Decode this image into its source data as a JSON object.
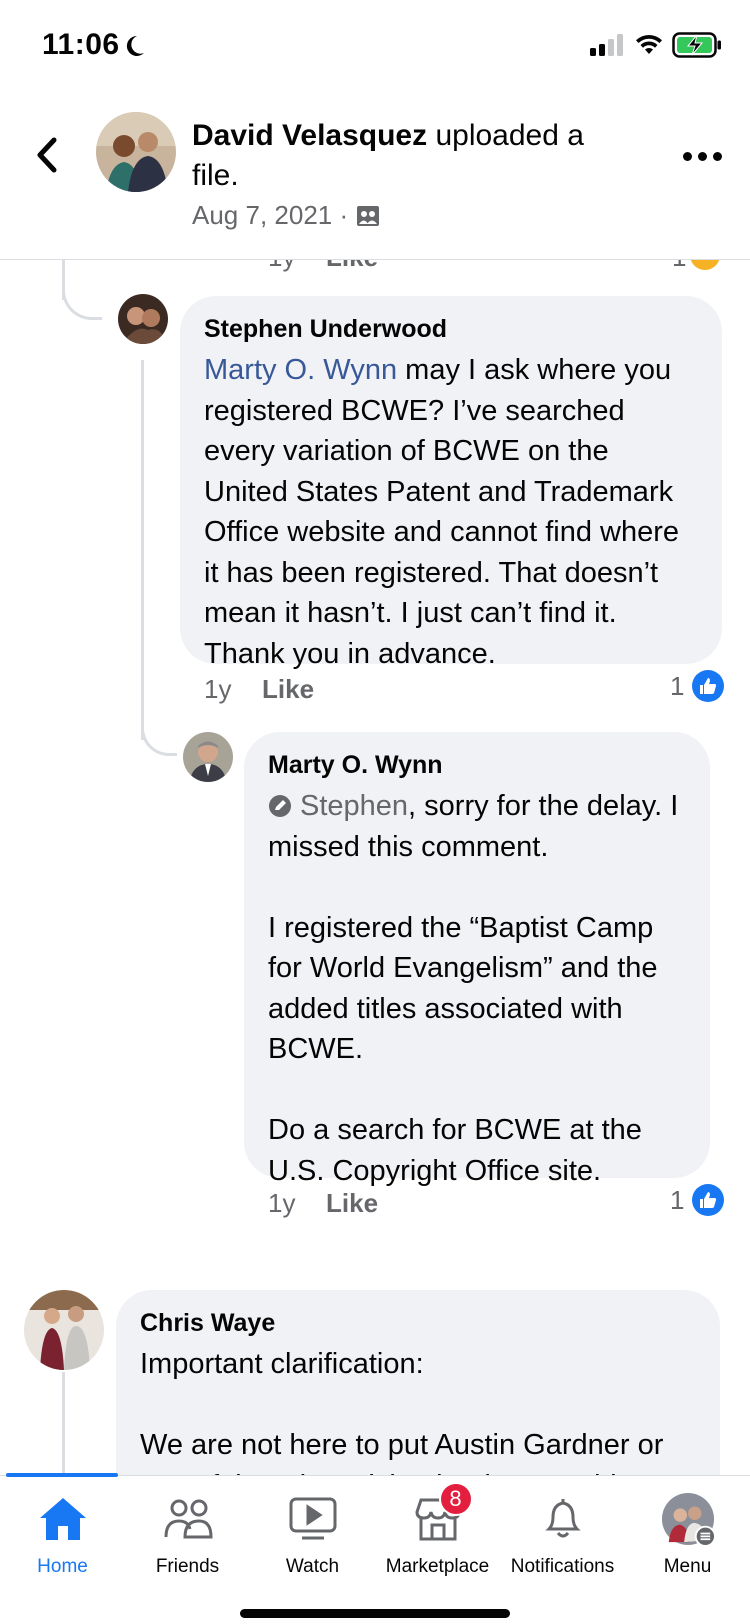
{
  "status_bar": {
    "time": "11:06"
  },
  "header": {
    "author": "David Velasquez",
    "action": " uploaded a file.",
    "date": "Aug 7, 2021 · "
  },
  "cutoff_comment": {
    "time": "1y",
    "like_label": "Like",
    "reaction_count": "1"
  },
  "comments": [
    {
      "author": "Stephen Underwood",
      "mention": "Marty O. Wynn",
      "text": " may I ask where you registered BCWE? I’ve searched every variation of BCWE on the United States Patent and Trademark Office website and cannot find where it has been registered. That doesn’t mean it hasn’t. I just can’t find it. Thank you in advance.",
      "time": "1y",
      "like_label": "Like",
      "reaction_count": "1"
    },
    {
      "author": "Marty O. Wynn",
      "mention": "Stephen",
      "text": ", sorry for the delay. I missed this comment.\n\nI registered the “Baptist Camp for World Evangelism” and the added titles associated with BCWE.\n\nDo a search for BCWE at the U.S. Copyright Office site.",
      "time": "1y",
      "like_label": "Like",
      "reaction_count": "1"
    },
    {
      "author": "Chris Waye",
      "text": "Important clarification:\n\nWe are not here to put Austin Gardner or any of the other Vision leaders outside"
    }
  ],
  "tabs": [
    {
      "label": "Home",
      "icon": "home-icon",
      "active": true
    },
    {
      "label": "Friends",
      "icon": "friends-icon"
    },
    {
      "label": "Watch",
      "icon": "watch-icon"
    },
    {
      "label": "Marketplace",
      "icon": "marketplace-icon",
      "badge": "8"
    },
    {
      "label": "Notifications",
      "icon": "bell-icon"
    },
    {
      "label": "Menu",
      "icon": "menu-avatar"
    }
  ],
  "colors": {
    "accent": "#1877f2",
    "bubble": "#f0f2f5",
    "secondary_text": "#65676b",
    "badge": "#e41e3f"
  }
}
